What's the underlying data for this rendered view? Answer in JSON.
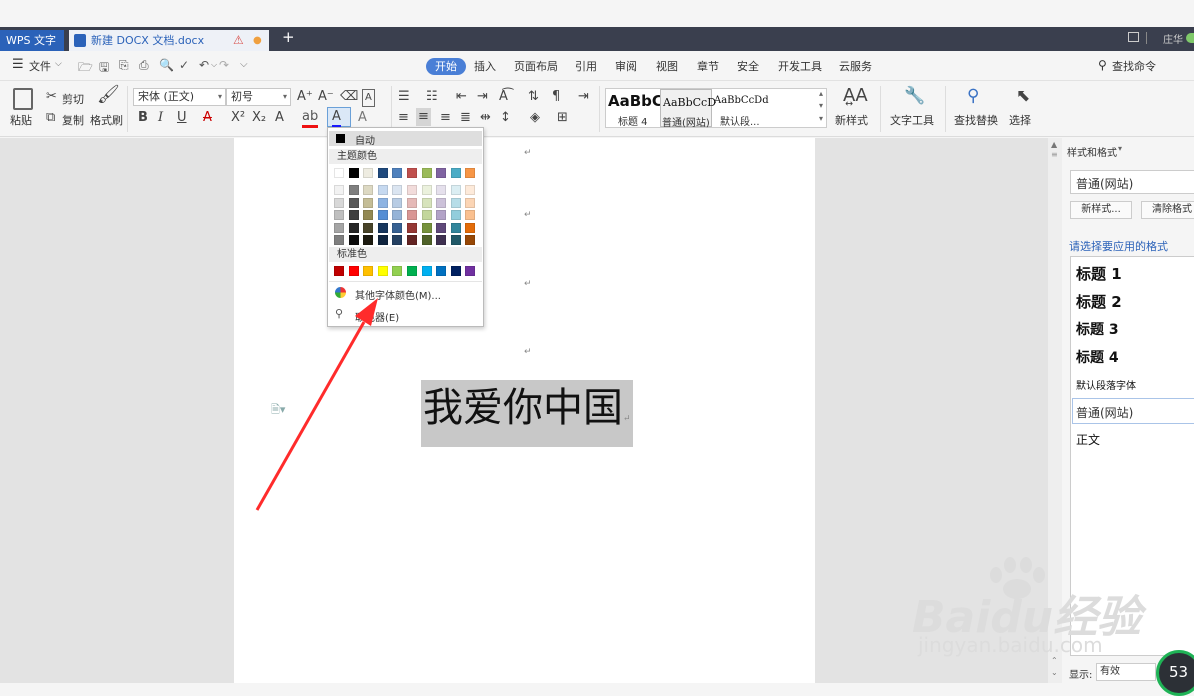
{
  "tabs": {
    "app": "WPS 文字",
    "doc": "新建 DOCX 文档.docx",
    "new_tab": "+"
  },
  "window": {
    "user": "庄华"
  },
  "menu": {
    "file": "文件",
    "items": [
      "开始",
      "插入",
      "页面布局",
      "引用",
      "审阅",
      "视图",
      "章节",
      "安全",
      "开发工具",
      "云服务"
    ],
    "search": "查找命令"
  },
  "ribbon": {
    "paste": "粘贴",
    "cut": "剪切",
    "copy": "复制",
    "format_painter": "格式刷",
    "font_name": "宋体 (正文)",
    "font_size": "初号",
    "style_previews": [
      "AaBbC",
      "AaBbCcD",
      "AaBbCcDd"
    ],
    "style_names": [
      "标题 4",
      "普通(网站)",
      "默认段..."
    ],
    "new_style": "新样式",
    "text_tools": "文字工具",
    "find_replace": "查找替换",
    "select": "选择"
  },
  "document": {
    "heading_text": "我爱你中国"
  },
  "panel": {
    "title": "样式和格式",
    "current_style": "普通(网站)",
    "new_style_btn": "新样式...",
    "clear_format_btn": "清除格式",
    "apply_label": "请选择要应用的格式",
    "styles": [
      "标题  1",
      "标题  2",
      "标题  3",
      "标题  4",
      "默认段落字体",
      "普通(网站)",
      "正文"
    ],
    "show_label": "显示:",
    "show_value": "有效",
    "badge": "53"
  },
  "color_dropdown": {
    "auto": "自动",
    "theme_label": "主题颜色",
    "standard_label": "标准色",
    "more_colors": "其他字体颜色(M)...",
    "eyedropper": "取色器(E)",
    "theme_top": [
      "#ffffff",
      "#000000",
      "#eeece1",
      "#1f497d",
      "#4f81bd",
      "#c0504d",
      "#9bbb59",
      "#8064a2",
      "#4bacc6",
      "#f79646"
    ],
    "theme_shades": [
      [
        "#f2f2f2",
        "#7f7f7f",
        "#ddd9c3",
        "#c6d9f0",
        "#dbe5f1",
        "#f2dcdb",
        "#ebf1dd",
        "#e5e0ec",
        "#dbeef3",
        "#fdeada"
      ],
      [
        "#d8d8d8",
        "#595959",
        "#c4bd97",
        "#8db3e2",
        "#b8cce4",
        "#e5b9b7",
        "#d7e3bc",
        "#ccc1d9",
        "#b7dde8",
        "#fbd5b5"
      ],
      [
        "#bfbfbf",
        "#3f3f3f",
        "#938953",
        "#548dd4",
        "#95b3d7",
        "#d99694",
        "#c3d69b",
        "#b2a2c7",
        "#92cddc",
        "#fac08f"
      ],
      [
        "#a5a5a5",
        "#262626",
        "#494429",
        "#17365d",
        "#366092",
        "#953734",
        "#76923c",
        "#5f497a",
        "#31859b",
        "#e36c09"
      ],
      [
        "#7f7f7f",
        "#0c0c0c",
        "#1d1b10",
        "#0f243e",
        "#244061",
        "#632423",
        "#4f6128",
        "#3f3151",
        "#205867",
        "#974806"
      ]
    ],
    "standard": [
      "#c00000",
      "#ff0000",
      "#ffc000",
      "#ffff00",
      "#92d050",
      "#00b050",
      "#00b0f0",
      "#0070c0",
      "#002060",
      "#7030a0"
    ]
  },
  "watermark": {
    "brand": "Baidu经验",
    "url": "jingyan.baidu.com"
  },
  "colors": {
    "accent": "#4a7fd6",
    "tab_bar": "#3a3f4e",
    "arrow": "#ff2b2b"
  }
}
